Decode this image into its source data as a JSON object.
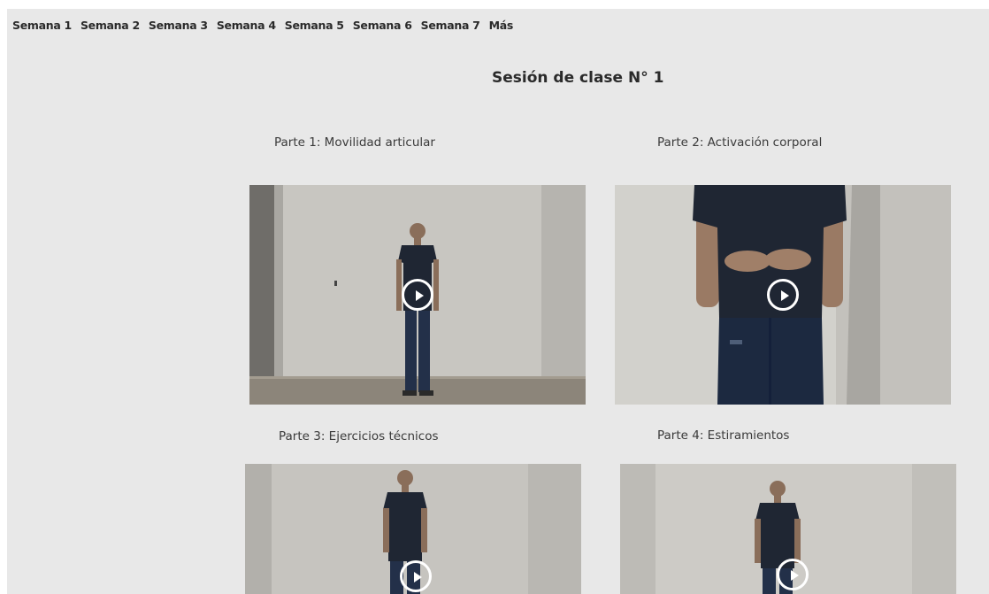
{
  "nav": {
    "items": [
      "Semana 1",
      "Semana 2",
      "Semana 3",
      "Semana 4",
      "Semana 5",
      "Semana 6",
      "Semana 7",
      "Más"
    ]
  },
  "session": {
    "title": "Sesión de clase N° 1"
  },
  "parts": [
    {
      "title": "Parte 1: Movilidad articular",
      "icon": "play-icon"
    },
    {
      "title": "Parte 2: Activación corporal",
      "icon": "play-icon"
    },
    {
      "title": "Parte 3: Ejercicios técnicos",
      "icon": "play-icon"
    },
    {
      "title": "Parte 4: Estiramientos",
      "icon": "play-icon"
    }
  ],
  "colors": {
    "page_background": "#e8e8e8",
    "text": "#2a2a2a",
    "video_wall": "#c9c7c2",
    "shirt": "#1f2633"
  }
}
